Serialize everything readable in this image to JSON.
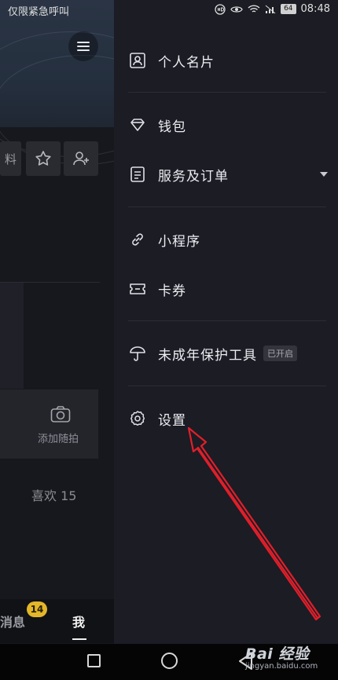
{
  "status_bar": {
    "carrier": "仅限紧急呼叫",
    "battery": "64",
    "time": "08:48"
  },
  "profile_page": {
    "edit_button_partial": "料",
    "snap_label": "添加随拍",
    "likes": "喜欢 15",
    "tabs": {
      "messages_label": "消息",
      "messages_badge": "14",
      "me_label": "我"
    }
  },
  "drawer": {
    "items": [
      {
        "label": "个人名片",
        "icon": "id-card-icon"
      },
      {
        "label": "钱包",
        "icon": "diamond-icon"
      },
      {
        "label": "服务及订单",
        "icon": "order-list-icon"
      },
      {
        "label": "小程序",
        "icon": "link-icon"
      },
      {
        "label": "卡券",
        "icon": "ticket-icon"
      },
      {
        "label": "未成年保护工具",
        "icon": "umbrella-icon",
        "tag": "已开启"
      },
      {
        "label": "设置",
        "icon": "gear-icon"
      }
    ]
  },
  "watermark": {
    "brand": "Bai 经验",
    "url": "jingyan.baidu.com"
  },
  "colors": {
    "drawer_bg": "#1b1c24",
    "badge": "#e4b72b",
    "annotation_arrow": "#e01f2a"
  }
}
